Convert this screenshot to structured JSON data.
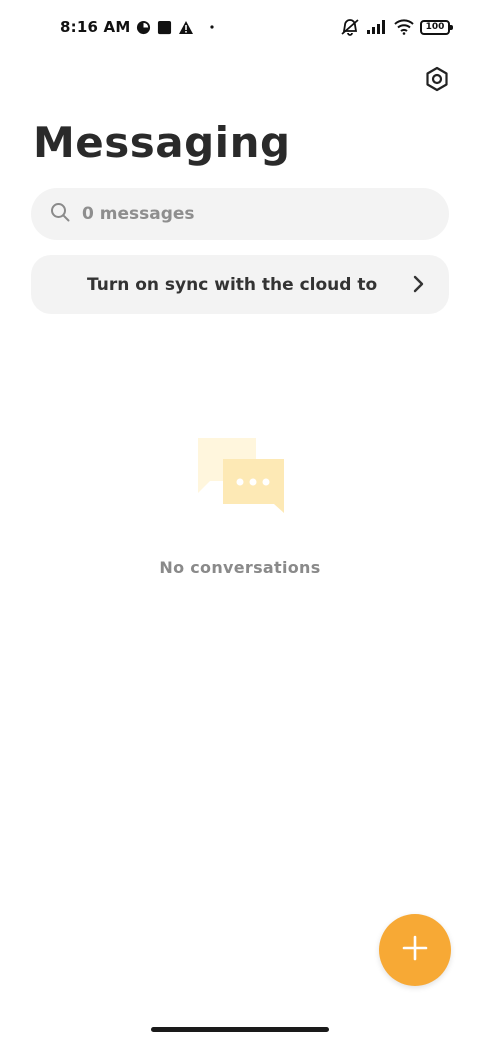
{
  "status_bar": {
    "time": "8:16 AM",
    "battery": "100",
    "icons_left": [
      "clock-icon",
      "square-notification-icon",
      "alert-icon",
      "dot-icon"
    ],
    "icons_right": [
      "mute-icon",
      "signal-icon",
      "wifi-icon",
      "battery-icon"
    ]
  },
  "header": {
    "title": "Messaging",
    "settings_icon": "settings-icon"
  },
  "search": {
    "placeholder": "0 messages",
    "icon": "search-icon"
  },
  "sync_banner": {
    "text": "Turn on sync with the cloud to",
    "icon": "chevron-right-icon"
  },
  "empty_state": {
    "text": "No conversations",
    "icon": "chat-bubbles-icon"
  },
  "fab": {
    "icon": "plus-icon"
  },
  "colors": {
    "accent": "#f7a935",
    "surface": "#f3f3f3",
    "illustration_back": "#fff6dd",
    "illustration_front": "#fde9b5"
  }
}
